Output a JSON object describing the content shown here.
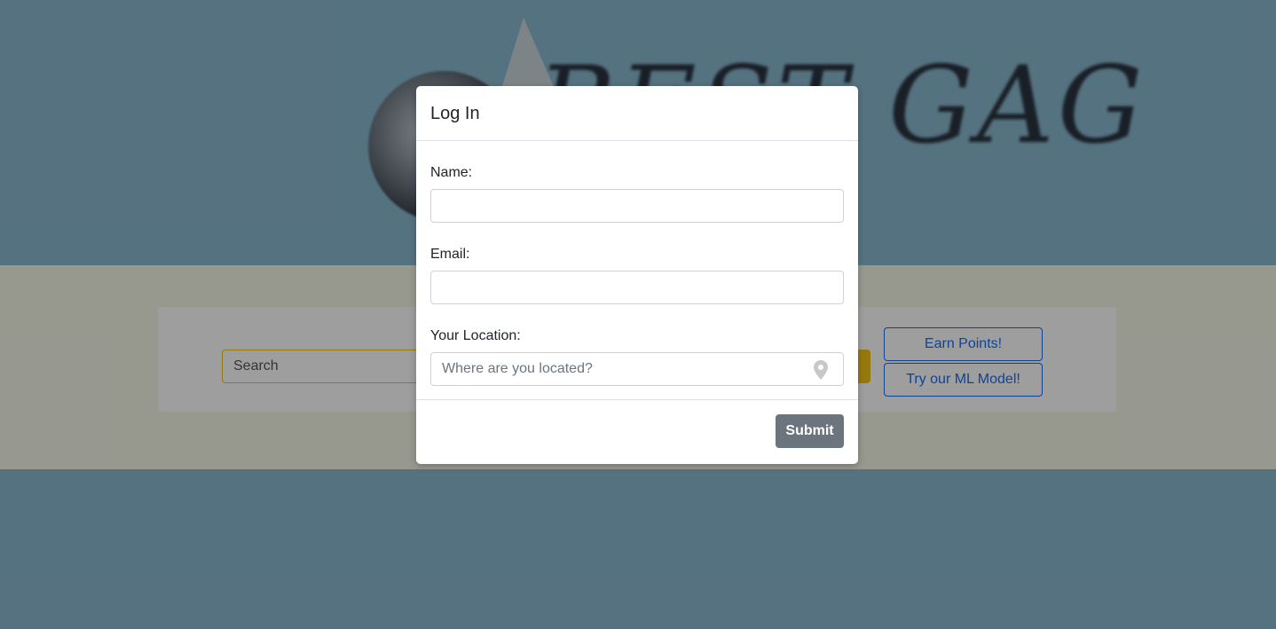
{
  "logo": {
    "text": "BEST GAG"
  },
  "search": {
    "placeholder": "Search"
  },
  "side_buttons": {
    "earn_points": "Earn Points!",
    "try_ml": "Try our ML Model!"
  },
  "modal": {
    "title": "Log In",
    "name_label": "Name:",
    "name_value": "",
    "email_label": "Email:",
    "email_value": "",
    "location_label": "Your Location:",
    "location_placeholder": "Where are you located?",
    "location_icon": "map-pin-icon",
    "submit_label": "Submit"
  },
  "colors": {
    "page_background": "#8ab8cf",
    "search_band": "#f4f6e6",
    "accent_yellow": "#f0c419",
    "button_blue": "#1a6df0",
    "submit_gray": "#6c757d"
  }
}
